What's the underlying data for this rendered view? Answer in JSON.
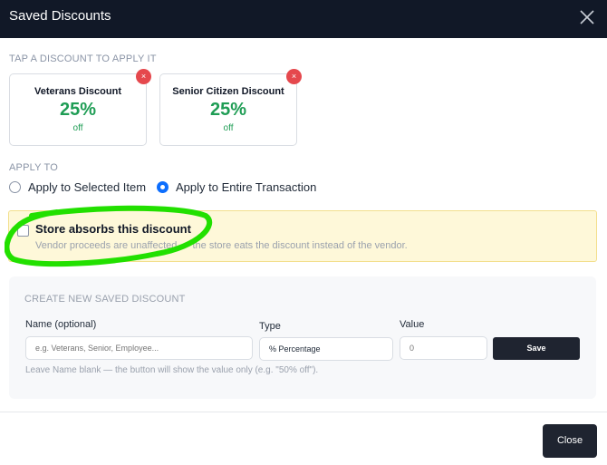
{
  "modal": {
    "title": "Saved Discounts",
    "close_icon": "close-icon"
  },
  "saved": {
    "label": "TAP A DISCOUNT TO APPLY IT",
    "cards": [
      {
        "name": "Veterans Discount",
        "value": "25%",
        "suffix": "off",
        "delete_glyph": "×"
      },
      {
        "name": "Senior Citizen Discount",
        "value": "25%",
        "suffix": "off",
        "delete_glyph": "×"
      }
    ]
  },
  "apply_to": {
    "label": "APPLY TO",
    "options": [
      {
        "label": "Apply to Selected Item",
        "checked": false
      },
      {
        "label": "Apply to Entire Transaction",
        "checked": true
      }
    ]
  },
  "absorb": {
    "checked": false,
    "title": "Store absorbs this discount",
    "subtitle": "Vendor proceeds are unaffected — the store eats the discount instead of the vendor."
  },
  "create": {
    "title": "CREATE NEW SAVED DISCOUNT",
    "name_label": "Name (optional)",
    "name_placeholder": "e.g. Veterans, Senior, Employee...",
    "type_label": "Type",
    "type_value": "% Percentage",
    "value_label": "Value",
    "value_placeholder": "0",
    "save_label": "Save",
    "hint": "Leave Name blank — the button will show the value only (e.g. \"50% off\")."
  },
  "footer": {
    "close_label": "Close"
  },
  "colors": {
    "header_bg": "#111827",
    "accent_green": "#1f9d55",
    "radio_blue": "#0d6efd",
    "delete_red": "#e5484d",
    "absorb_bg": "#fef8d9",
    "annotation_green": "#22e000"
  }
}
